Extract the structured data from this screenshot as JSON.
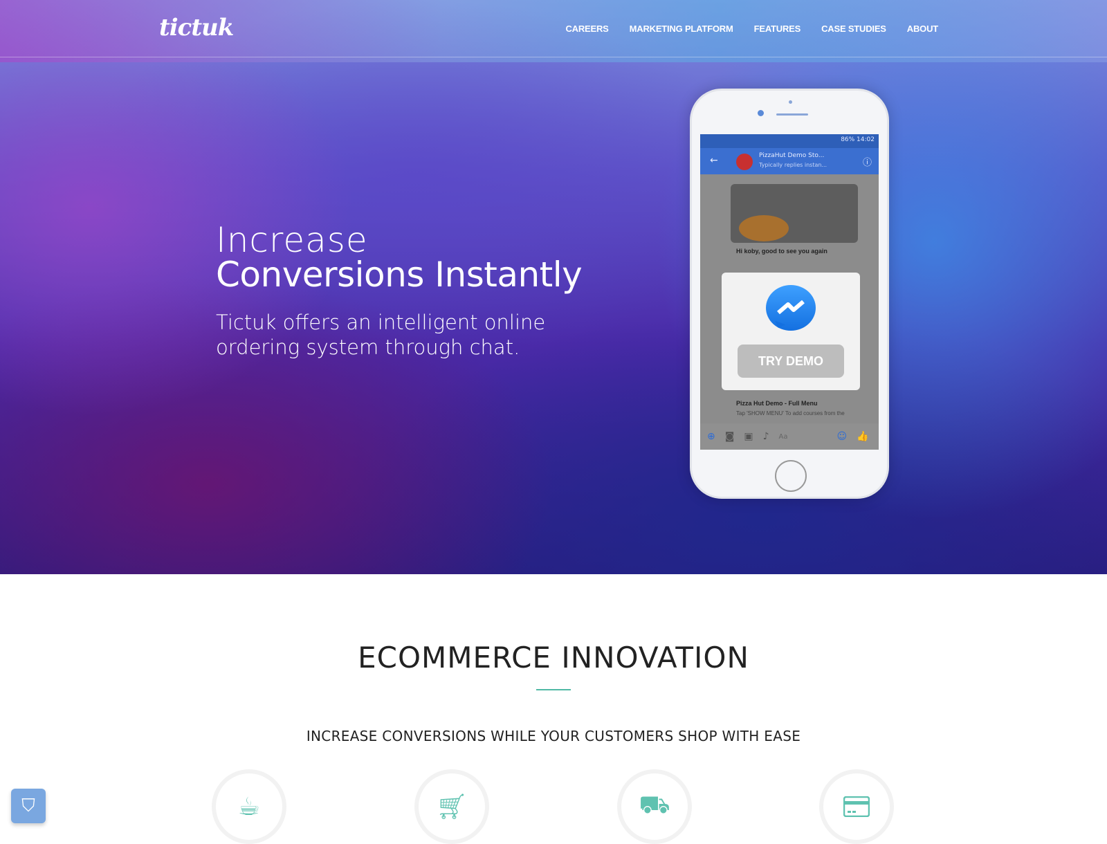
{
  "nav": {
    "logo": "tictuk",
    "items": [
      "CAREERS",
      "MARKETING PLATFORM",
      "FEATURES",
      "CASE STUDIES",
      "ABOUT"
    ]
  },
  "hero": {
    "line1": "Increase",
    "line2": "Conversions Instantly",
    "subtitle": "Tictuk offers an intelligent online ordering system through chat."
  },
  "phone": {
    "status": "86% 14:02",
    "chat_name": "PizzaHut Demo Sto...",
    "chat_status": "Typically replies instan...",
    "greeting": "Hi koby, good to see you again",
    "menu_title": "Pizza Hut Demo - Full Menu",
    "menu_desc": "Tap 'SHOW MENU' To add courses from the",
    "input_placeholder": "Aa",
    "try_demo": "TRY DEMO"
  },
  "section": {
    "title": "ECOMMERCE INNOVATION",
    "subtitle": "INCREASE CONVERSIONS WHILE YOUR CUSTOMERS SHOP WITH EASE",
    "features": [
      {
        "icon": "coffee-cup-icon"
      },
      {
        "icon": "shopping-cart-icon"
      },
      {
        "icon": "truck-icon"
      },
      {
        "icon": "credit-card-icon"
      }
    ]
  },
  "colors": {
    "accent": "#5fc2b0",
    "messenger": "#1e88f0"
  }
}
